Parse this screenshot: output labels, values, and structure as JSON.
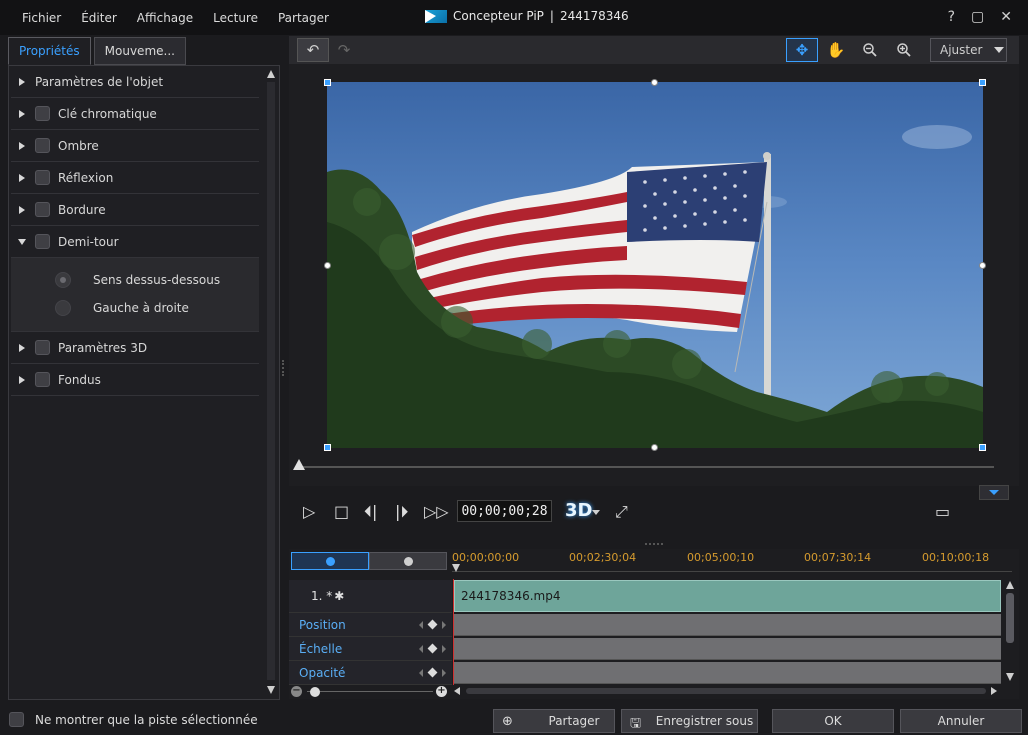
{
  "menu": [
    "Fichier",
    "Éditer",
    "Affichage",
    "Lecture",
    "Partager"
  ],
  "window": {
    "title": "Concepteur PiP",
    "separator": "|",
    "project_id": "244178346"
  },
  "left_tabs": [
    {
      "label": "Propriétés"
    },
    {
      "label": "Mouveme..."
    }
  ],
  "properties": [
    {
      "label": "Paramètres de l'objet"
    },
    {
      "label": "Clé chromatique"
    },
    {
      "label": "Ombre"
    },
    {
      "label": "Réflexion"
    },
    {
      "label": "Bordure"
    },
    {
      "label": "Demi-tour"
    },
    {
      "label": "Paramètres 3D"
    },
    {
      "label": "Fondus"
    }
  ],
  "flip_options": [
    {
      "label": "Sens dessus-dessous",
      "selected": true
    },
    {
      "label": "Gauche à droite",
      "selected": false
    }
  ],
  "preview": {
    "fit_label": "Ajuster"
  },
  "player": {
    "timecode": "00;00;00;28",
    "three_d_label": "3D"
  },
  "timeline": {
    "ruler": [
      "00;00;00;00",
      "00;02;30;04",
      "00;05;00;10",
      "00;07;30;14",
      "00;10;00;18"
    ],
    "track_label": "1. *",
    "clip_name": "244178346.mp4",
    "keyframe_tracks": [
      "Position",
      "Échelle",
      "Opacité"
    ]
  },
  "footer": {
    "only_selected_label": "Ne montrer que la piste sélectionnée",
    "share_label": "Partager",
    "save_as_label": "Enregistrer sous",
    "ok_label": "OK",
    "cancel_label": "Annuler"
  },
  "colors": {
    "accent": "#3aa0ff",
    "clip": "#6ea59a",
    "ruler_text": "#d59b2e"
  }
}
